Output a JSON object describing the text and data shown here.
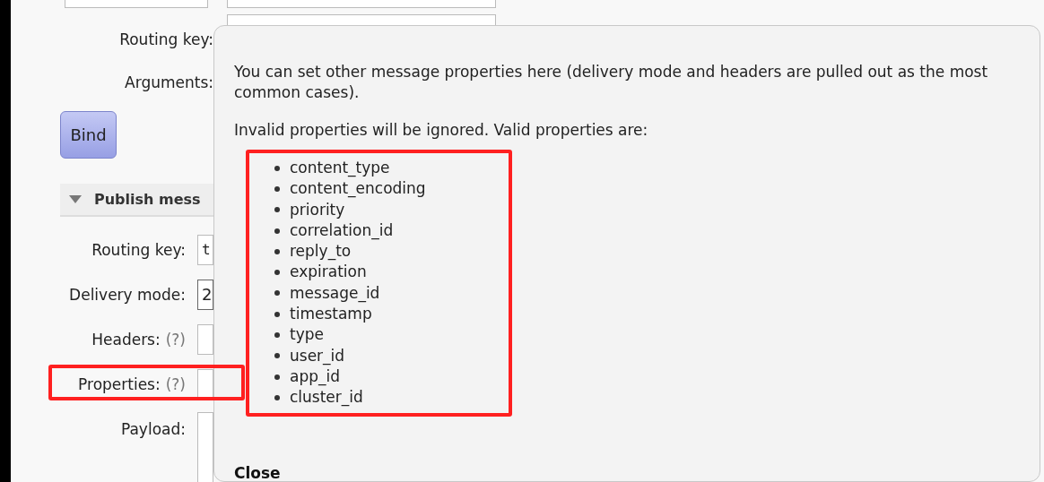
{
  "binding_form": {
    "rows": [
      {
        "label": "Routing key:"
      },
      {
        "label": "Arguments:"
      }
    ],
    "button": "Bind"
  },
  "publish_section": {
    "title": "Publish mess",
    "expanded": true,
    "rows": [
      {
        "label": "Routing key:",
        "kind": "input",
        "value": "t"
      },
      {
        "label": "Delivery mode:",
        "kind": "select",
        "value": "2"
      },
      {
        "label": "Headers:",
        "help": "(?)",
        "kind": "input"
      },
      {
        "label": "Properties:",
        "help": "(?)",
        "kind": "input"
      },
      {
        "label": "Payload:",
        "kind": "textarea"
      }
    ]
  },
  "help_popup": {
    "paragraphs": [
      "You can set other message properties here (delivery mode and headers are pulled out as the most common cases).",
      "Invalid properties will be ignored. Valid properties are:"
    ],
    "properties": [
      "content_type",
      "content_encoding",
      "priority",
      "correlation_id",
      "reply_to",
      "expiration",
      "message_id",
      "timestamp",
      "type",
      "user_id",
      "app_id",
      "cluster_id"
    ],
    "close": "Close"
  }
}
